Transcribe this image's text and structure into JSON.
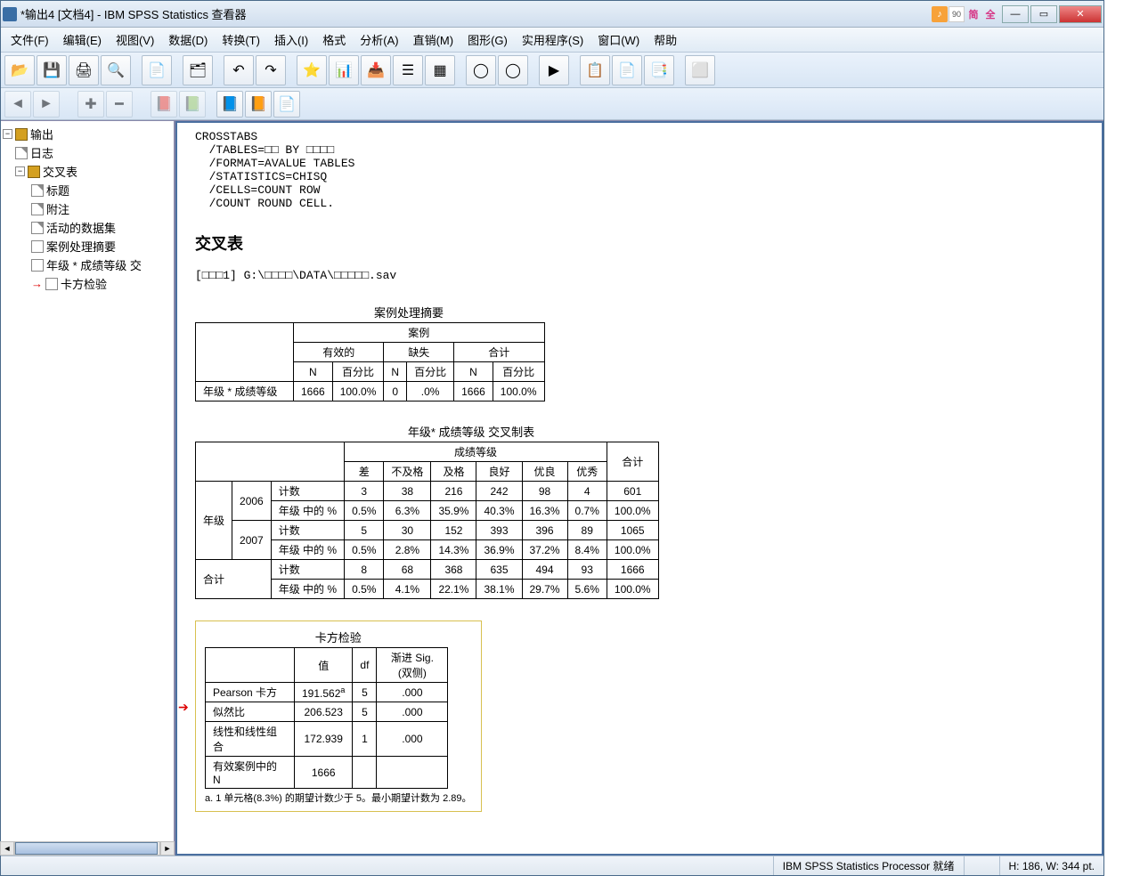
{
  "title": "*输出4 [文档4] - IBM SPSS Statistics 查看器",
  "ime": {
    "a": "♪",
    "b": "90",
    "c": "简",
    "d": "全"
  },
  "menus": [
    "文件(F)",
    "编辑(E)",
    "视图(V)",
    "数据(D)",
    "转换(T)",
    "插入(I)",
    "格式",
    "分析(A)",
    "直销(M)",
    "图形(G)",
    "实用程序(S)",
    "窗口(W)",
    "帮助"
  ],
  "tree": {
    "root": "输出",
    "log": "日志",
    "crosstabs": "交叉表",
    "items": [
      "标题",
      "附注",
      "活动的数据集",
      "案例处理摘要",
      "年级 * 成绩等级  交",
      "卡方检验"
    ]
  },
  "syntax": "CROSSTABS\n  /TABLES=□□ BY □□□□\n  /FORMAT=AVALUE TABLES\n  /STATISTICS=CHISQ\n  /CELLS=COUNT ROW\n  /COUNT ROUND CELL.",
  "section_title": "交叉表",
  "dataset_line": "[□□□1] G:\\□□□□\\DATA\\□□□□□.sav",
  "case_summary": {
    "title": "案例处理摘要",
    "top": "案例",
    "cols_grp": [
      "有效的",
      "缺失",
      "合计"
    ],
    "sub": [
      "N",
      "百分比"
    ],
    "row_label": "年级 * 成绩等级",
    "row": [
      "1666",
      "100.0%",
      "0",
      ".0%",
      "1666",
      "100.0%"
    ]
  },
  "crosstab": {
    "title": "年级* 成绩等级 交叉制表",
    "col_var": "成绩等级",
    "cols": [
      "差",
      "不及格",
      "及格",
      "良好",
      "优良",
      "优秀"
    ],
    "total_col": "合计",
    "row_var": "年级",
    "count_label": "计数",
    "pct_label": "年级 中的 %",
    "total_row": "合计",
    "data": {
      "2006": {
        "count": [
          "3",
          "38",
          "216",
          "242",
          "98",
          "4",
          "601"
        ],
        "pct": [
          "0.5%",
          "6.3%",
          "35.9%",
          "40.3%",
          "16.3%",
          "0.7%",
          "100.0%"
        ]
      },
      "2007": {
        "count": [
          "5",
          "30",
          "152",
          "393",
          "396",
          "89",
          "1065"
        ],
        "pct": [
          "0.5%",
          "2.8%",
          "14.3%",
          "36.9%",
          "37.2%",
          "8.4%",
          "100.0%"
        ]
      },
      "total": {
        "count": [
          "8",
          "68",
          "368",
          "635",
          "494",
          "93",
          "1666"
        ],
        "pct": [
          "0.5%",
          "4.1%",
          "22.1%",
          "38.1%",
          "29.7%",
          "5.6%",
          "100.0%"
        ]
      }
    }
  },
  "chisq": {
    "title": "卡方检验",
    "cols": [
      "值",
      "df",
      "渐进 Sig. (双侧)"
    ],
    "rows": [
      {
        "label": "Pearson 卡方",
        "v": "191.562",
        "sup": "a",
        "df": "5",
        "sig": ".000"
      },
      {
        "label": "似然比",
        "v": "206.523",
        "df": "5",
        "sig": ".000"
      },
      {
        "label": "线性和线性组合",
        "v": "172.939",
        "df": "1",
        "sig": ".000"
      },
      {
        "label": "有效案例中的 N",
        "v": "1666",
        "df": "",
        "sig": ""
      }
    ],
    "footnote": "a. 1 单元格(8.3%) 的期望计数少于 5。最小期望计数为 2.89。"
  },
  "status": {
    "processor": "IBM SPSS Statistics Processor 就绪",
    "dims": "H: 186, W: 344 pt."
  }
}
